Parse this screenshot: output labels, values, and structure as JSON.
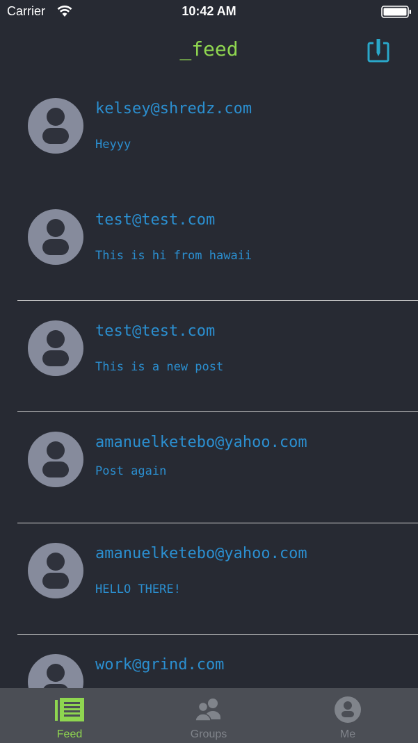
{
  "status_bar": {
    "carrier": "Carrier",
    "time": "10:42 AM",
    "wifi_icon": "wifi-icon",
    "battery_icon": "battery-full-icon"
  },
  "nav": {
    "title": "_feed",
    "compose_icon": "compose-icon"
  },
  "feed": {
    "posts": [
      {
        "email": "kelsey@shredz.com",
        "message": "Heyyy"
      },
      {
        "email": "test@test.com",
        "message": "This is hi from hawaii"
      },
      {
        "email": "test@test.com",
        "message": "This is a new post"
      },
      {
        "email": "amanuelketebo@yahoo.com",
        "message": "Post again"
      },
      {
        "email": "amanuelketebo@yahoo.com",
        "message": "HELLO THERE!"
      },
      {
        "email": "work@grind.com",
        "message": ""
      }
    ]
  },
  "tabs": [
    {
      "label": "Feed",
      "icon": "feed-list-icon",
      "active": true
    },
    {
      "label": "Groups",
      "icon": "group-icon",
      "active": false
    },
    {
      "label": "Me",
      "icon": "person-icon",
      "active": false
    }
  ],
  "colors": {
    "background": "#272a33",
    "accent_green": "#8fd650",
    "text_blue": "#2b8fd0",
    "avatar_gray": "#868b9c",
    "tab_bar": "#4b4e55",
    "compose_teal": "#2aa7c9"
  }
}
